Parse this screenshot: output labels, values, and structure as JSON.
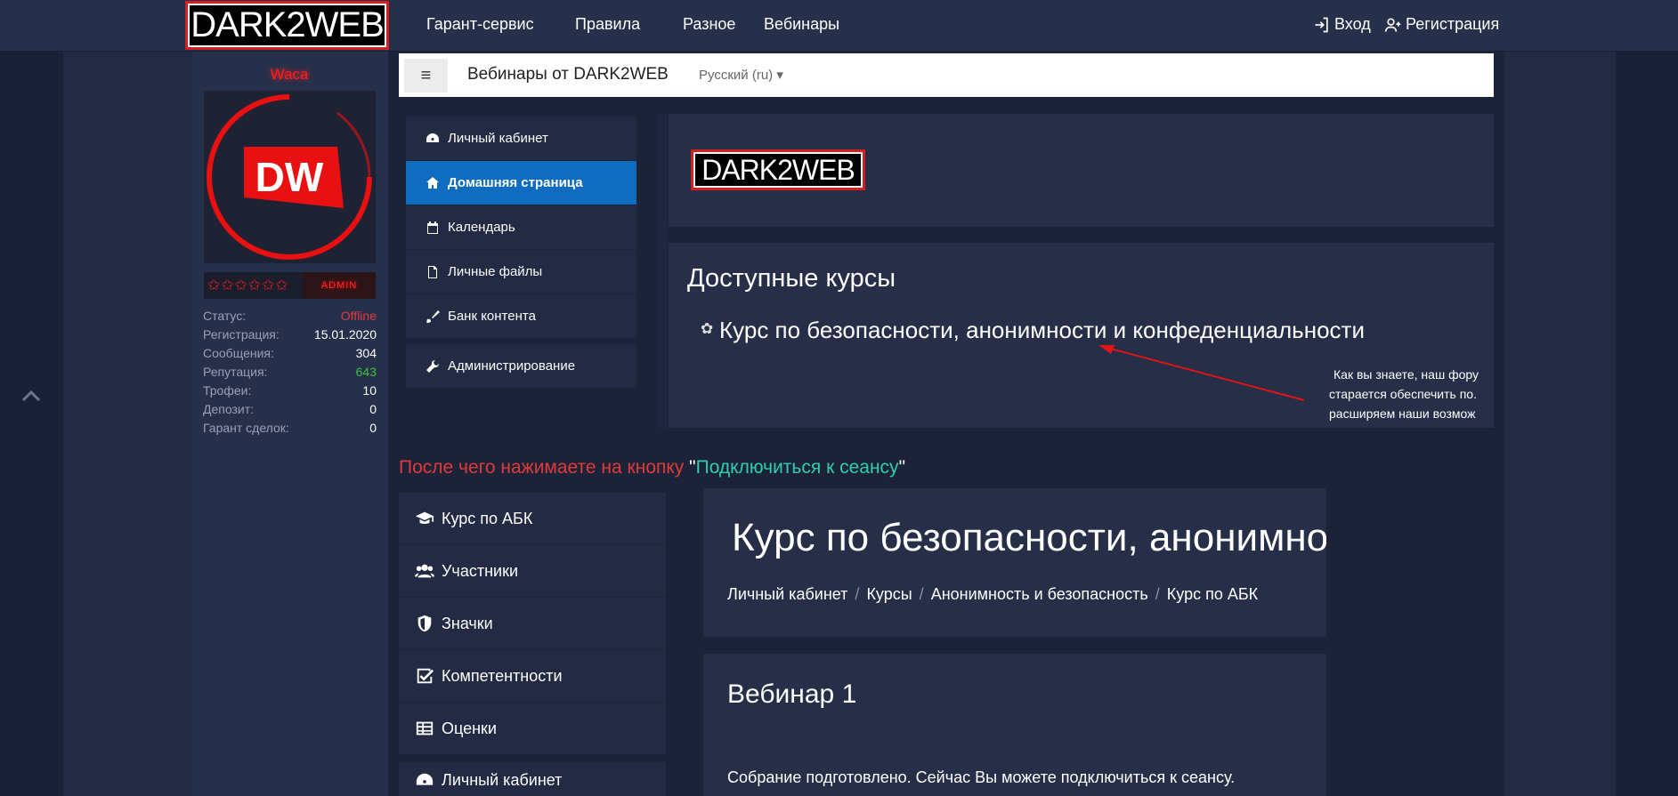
{
  "topbar": {
    "logo": "DARK2WEB",
    "nav": [
      "Гарант-сервис",
      "Правила",
      "Разное",
      "Вебинары"
    ],
    "login": "Вход",
    "register": "Регистрация"
  },
  "user": {
    "name": "Waca",
    "avatar_text": "DW",
    "rank": "ADMIN",
    "stats": [
      {
        "k": "Статус:",
        "v": "Offline",
        "color": "#e03b3b"
      },
      {
        "k": "Регистрация:",
        "v": "15.01.2020",
        "color": "#ffffff"
      },
      {
        "k": "Сообщения:",
        "v": "304",
        "color": "#ffffff"
      },
      {
        "k": "Репутация:",
        "v": "643",
        "color": "#3fbf3f"
      },
      {
        "k": "Трофеи:",
        "v": "10",
        "color": "#ffffff"
      },
      {
        "k": "Депозит:",
        "v": "0",
        "color": "#ffffff"
      },
      {
        "k": "Гарант сделок:",
        "v": "0",
        "color": "#ffffff"
      }
    ]
  },
  "ms": {
    "title": "Вебинары от DARK2WEB",
    "lang": "Русский (ru)",
    "menu": [
      "Личный кабинет",
      "Домашняя страница",
      "Календарь",
      "Личные файлы",
      "Банк контента"
    ],
    "menu2": "Администрирование",
    "logo": "DARK2WEB",
    "courses_title": "Доступные курсы",
    "course_link": "Курс по безопасности, анонимности и конфеденциальности",
    "side_note": [
      "Как вы знаете, наш фору",
      "старается обеспечить по.",
      "расширяем наши возмож"
    ]
  },
  "instruction": {
    "part1": "После чего нажимаете на кнопку ",
    "quote_open": "\"",
    "link": "Подключиться к сеансу",
    "quote_close": "\""
  },
  "ss2": {
    "menu": [
      "Курс по АБК",
      "Участники",
      "Значки",
      "Компетентности",
      "Оценки",
      "Личный кабинет"
    ],
    "heading": "Курс по безопасности, анонимности и конфеденциальности",
    "breadcrumbs": [
      "Личный кабинет",
      "Курсы",
      "Анонимность и безопасность",
      "Курс по АБК"
    ],
    "vebinar": "Вебинар 1",
    "message": "Собрание подготовлено. Сейчас Вы можете подключиться к сеансу."
  }
}
